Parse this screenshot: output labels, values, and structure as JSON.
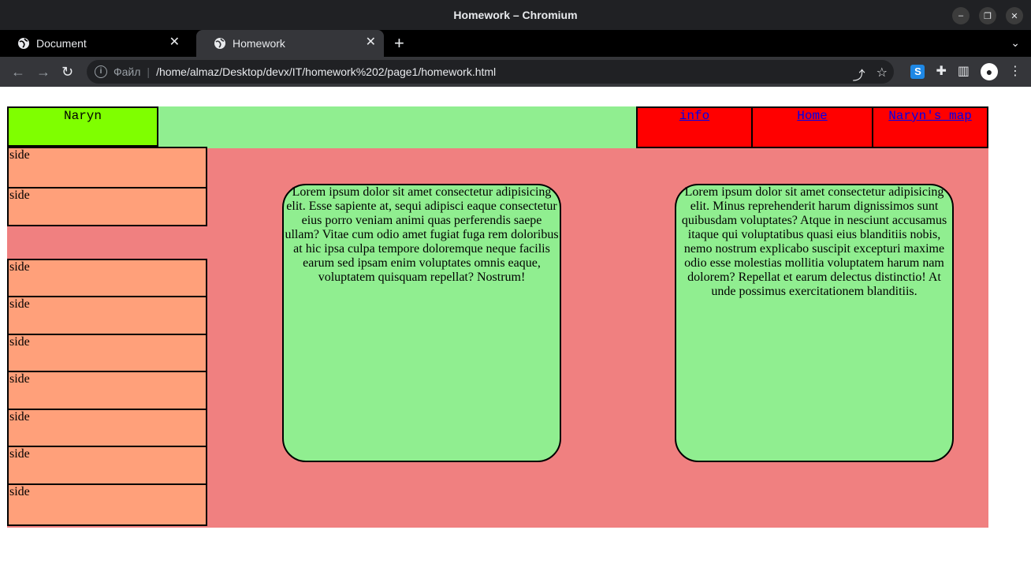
{
  "window": {
    "title": "Homework – Chromium",
    "controls": [
      "–",
      "❐",
      "✕"
    ]
  },
  "tabs": [
    {
      "label": "Document",
      "active": false
    },
    {
      "label": "Homework",
      "active": true
    }
  ],
  "address_bar": {
    "scheme_label": "Файл",
    "url": "/home/almaz/Desktop/devx/IT/homework%202/page1/homework.html"
  },
  "page": {
    "logo": "Naryn",
    "nav": [
      "info",
      "Home",
      "Naryn's map"
    ],
    "side_label": "side",
    "sidebar_items": [
      "side",
      "side",
      "side",
      "side",
      "side",
      "side",
      "side",
      "side",
      "side"
    ],
    "cards": [
      "Lorem ipsum dolor sit amet consectetur adipisicing elit. Esse sapiente at, sequi adipisci eaque consectetur eius porro veniam animi quas perferendis saepe ullam? Vitae cum odio amet fugiat fuga rem doloribus at hic ipsa culpa tempore doloremque neque facilis earum sed ipsam enim voluptates omnis eaque, voluptatem quisquam repellat? Nostrum!",
      "Lorem ipsum dolor sit amet consectetur adipisicing elit. Minus reprehenderit harum dignissimos sunt quibusdam voluptates? Atque in nesciunt accusamus itaque qui voluptatibus quasi eius blanditiis nobis, nemo nostrum explicabo suscipit excepturi maxime odio esse molestias mollitia voluptatem harum nam dolorem? Repellat et earum delectus distinctio! At unde possimus exercitationem blanditiis."
    ]
  },
  "colors": {
    "logo_bg": "#7fff00",
    "header_bg": "#90ee90",
    "nav_bg": "#ff0000",
    "main_bg": "#f08080",
    "side_bg": "#ffa07a",
    "card_bg": "#90ee90"
  }
}
